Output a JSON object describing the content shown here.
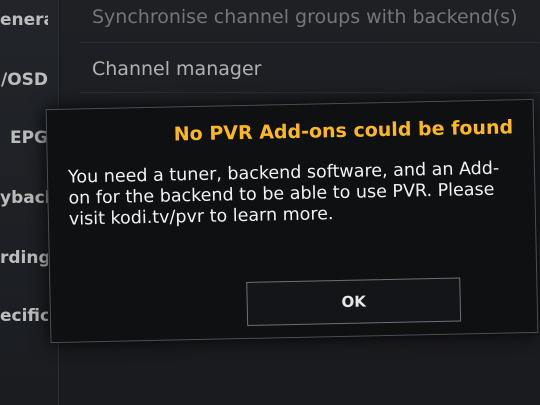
{
  "sidebar": {
    "items": [
      {
        "label": "eneral"
      },
      {
        "label": "/OSD"
      },
      {
        "label": "EPG"
      },
      {
        "label": "yback"
      },
      {
        "label": "rding"
      },
      {
        "label": "ecific"
      }
    ]
  },
  "main": {
    "items": [
      {
        "label": "Synchronise channel groups with backend(s)"
      },
      {
        "label": "Channel manager"
      }
    ]
  },
  "dialog": {
    "title": "No PVR Add-ons could be found",
    "message": "You need a tuner, backend software, and an Add-on for the backend to be able to use PVR. Please visit kodi.tv/pvr to learn more.",
    "ok_label": "OK"
  },
  "colors": {
    "title": "#ffb81c",
    "dialog_bg": "#0f1012",
    "text": "#f2f2f2"
  }
}
